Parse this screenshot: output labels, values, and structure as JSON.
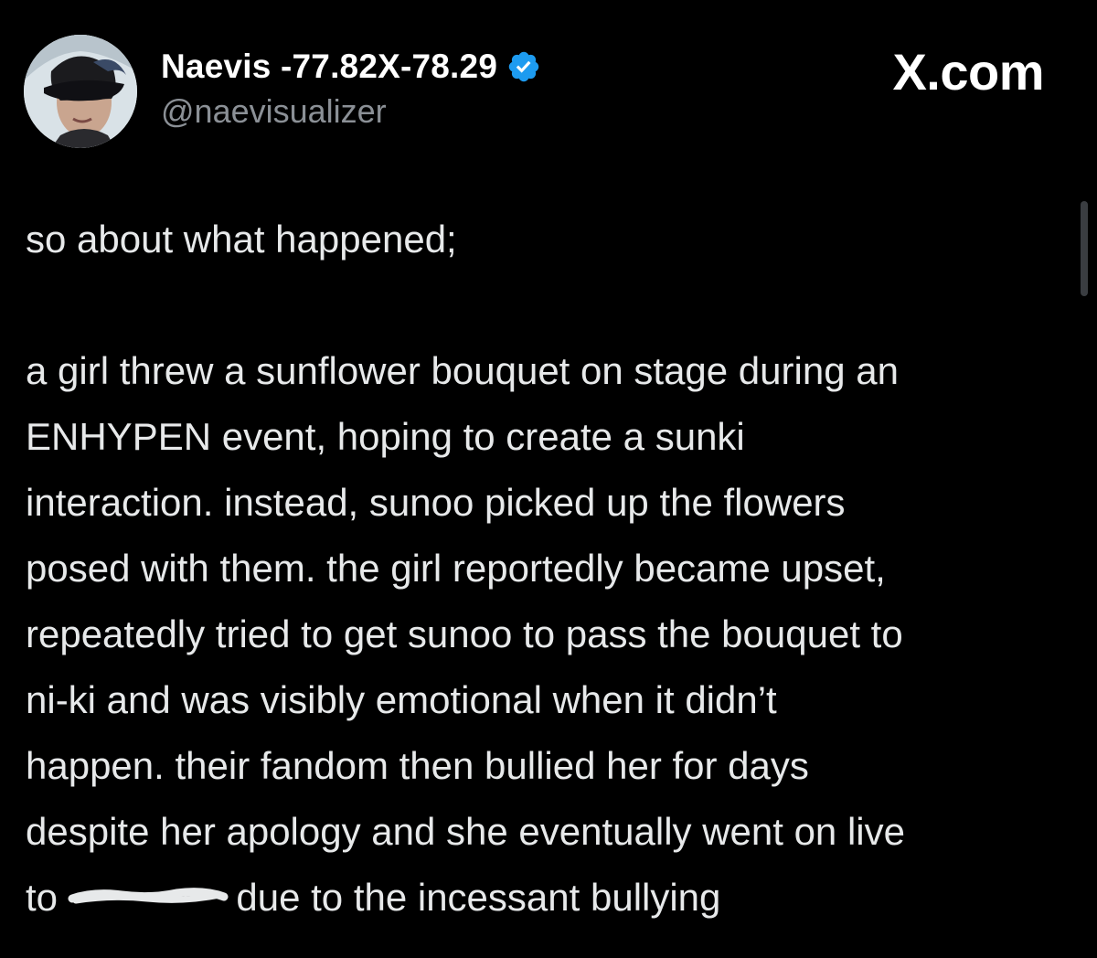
{
  "header": {
    "display_name": "Naevis -77.82X-78.29",
    "handle": "@naevisualizer",
    "brand": "X.com"
  },
  "icons": {
    "verified": "verified-badge-icon",
    "avatar": "profile-avatar"
  },
  "colors": {
    "verified": "#1d9bf0",
    "background": "#000000",
    "text": "#e7e9ea",
    "handle": "#8b9096"
  },
  "post": {
    "intro": "so about what happened;",
    "lines": [
      "a girl threw a sunflower bouquet on stage during an",
      "ENHYPEN event, hoping to create a sunki",
      "interaction. instead, sunoo picked up the flowers",
      "posed with them. the girl reportedly became upset,",
      "repeatedly tried to get sunoo to pass the bouquet to",
      "ni-ki and was visibly emotional when it didn’t",
      "happen. their fandom then bullied her for days",
      "despite her apology and she eventually went on live"
    ],
    "last_line_start": "to",
    "last_line_end": "due to the incessant bullying"
  }
}
